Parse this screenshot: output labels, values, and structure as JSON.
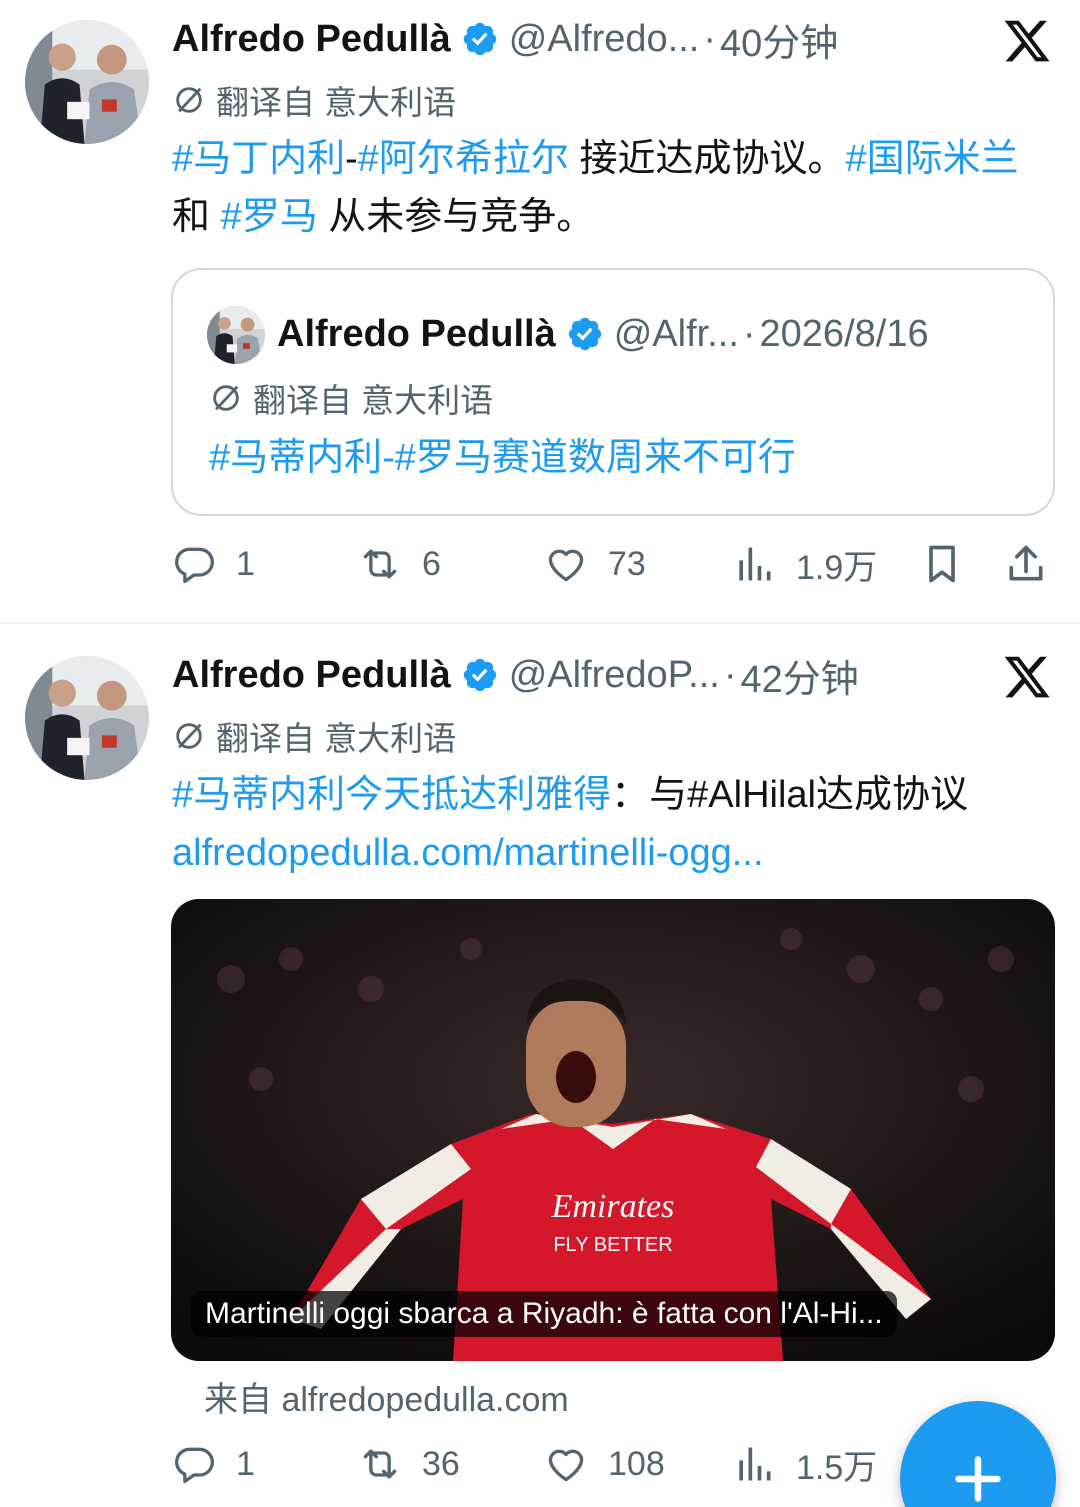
{
  "tweets": [
    {
      "author": "Alfredo Pedullà",
      "handle": "@Alfredo...",
      "dot": "·",
      "time": "40分钟",
      "translated": "翻译自 意大利语",
      "text": {
        "tag1": "#马丁内利",
        "dash": "-",
        "tag2": "#阿尔希拉尔",
        "t1": " 接近达成协议。",
        "tag3": "#国际米兰",
        "t2": " 和 ",
        "tag4": "#罗马",
        "t3": " 从未参与竞争。"
      },
      "quote": {
        "author": "Alfredo Pedullà",
        "handle": "@Alfr...",
        "dot": "·",
        "time": "2026/8/16",
        "translated": "翻译自 意大利语",
        "tag1": "#马蒂内利",
        "dash": "-",
        "tag2": "#罗马赛道数周来不可行"
      },
      "stats": {
        "replies": "1",
        "retweets": "6",
        "likes": "73",
        "views": "1.9万"
      }
    },
    {
      "author": "Alfredo Pedullà",
      "handle": "@AlfredoP...",
      "dot": "·",
      "time": "42分钟",
      "translated": "翻译自 意大利语",
      "text": {
        "tag1": "#马蒂内利今天抵达利雅得",
        "t1": "：与",
        "tag2": "#AlHilal",
        "t2": "达成协议",
        "link": "alfredopedulla.com/martinelli-ogg..."
      },
      "card": {
        "caption": "Martinelli oggi sbarca a Riyadh: è fatta con l'Al-Hi...",
        "jersey_sponsor": "Emirates",
        "jersey_tagline": "FLY BETTER",
        "from": "来自 alfredopedulla.com"
      },
      "stats": {
        "replies": "1",
        "retweets": "36",
        "likes": "108",
        "views": "1.5万"
      }
    }
  ],
  "icons": {
    "verified": "verified-badge-icon",
    "x_logo": "x-logo-icon",
    "translate": "translate-icon",
    "reply": "reply-icon",
    "retweet": "retweet-icon",
    "like": "heart-icon",
    "views": "views-icon",
    "bookmark": "bookmark-icon",
    "share": "share-icon",
    "compose": "plus-icon"
  },
  "colors": {
    "accent": "#1d9bf0",
    "muted": "#536471",
    "text": "#0f1419",
    "border": "#cfd9de"
  }
}
